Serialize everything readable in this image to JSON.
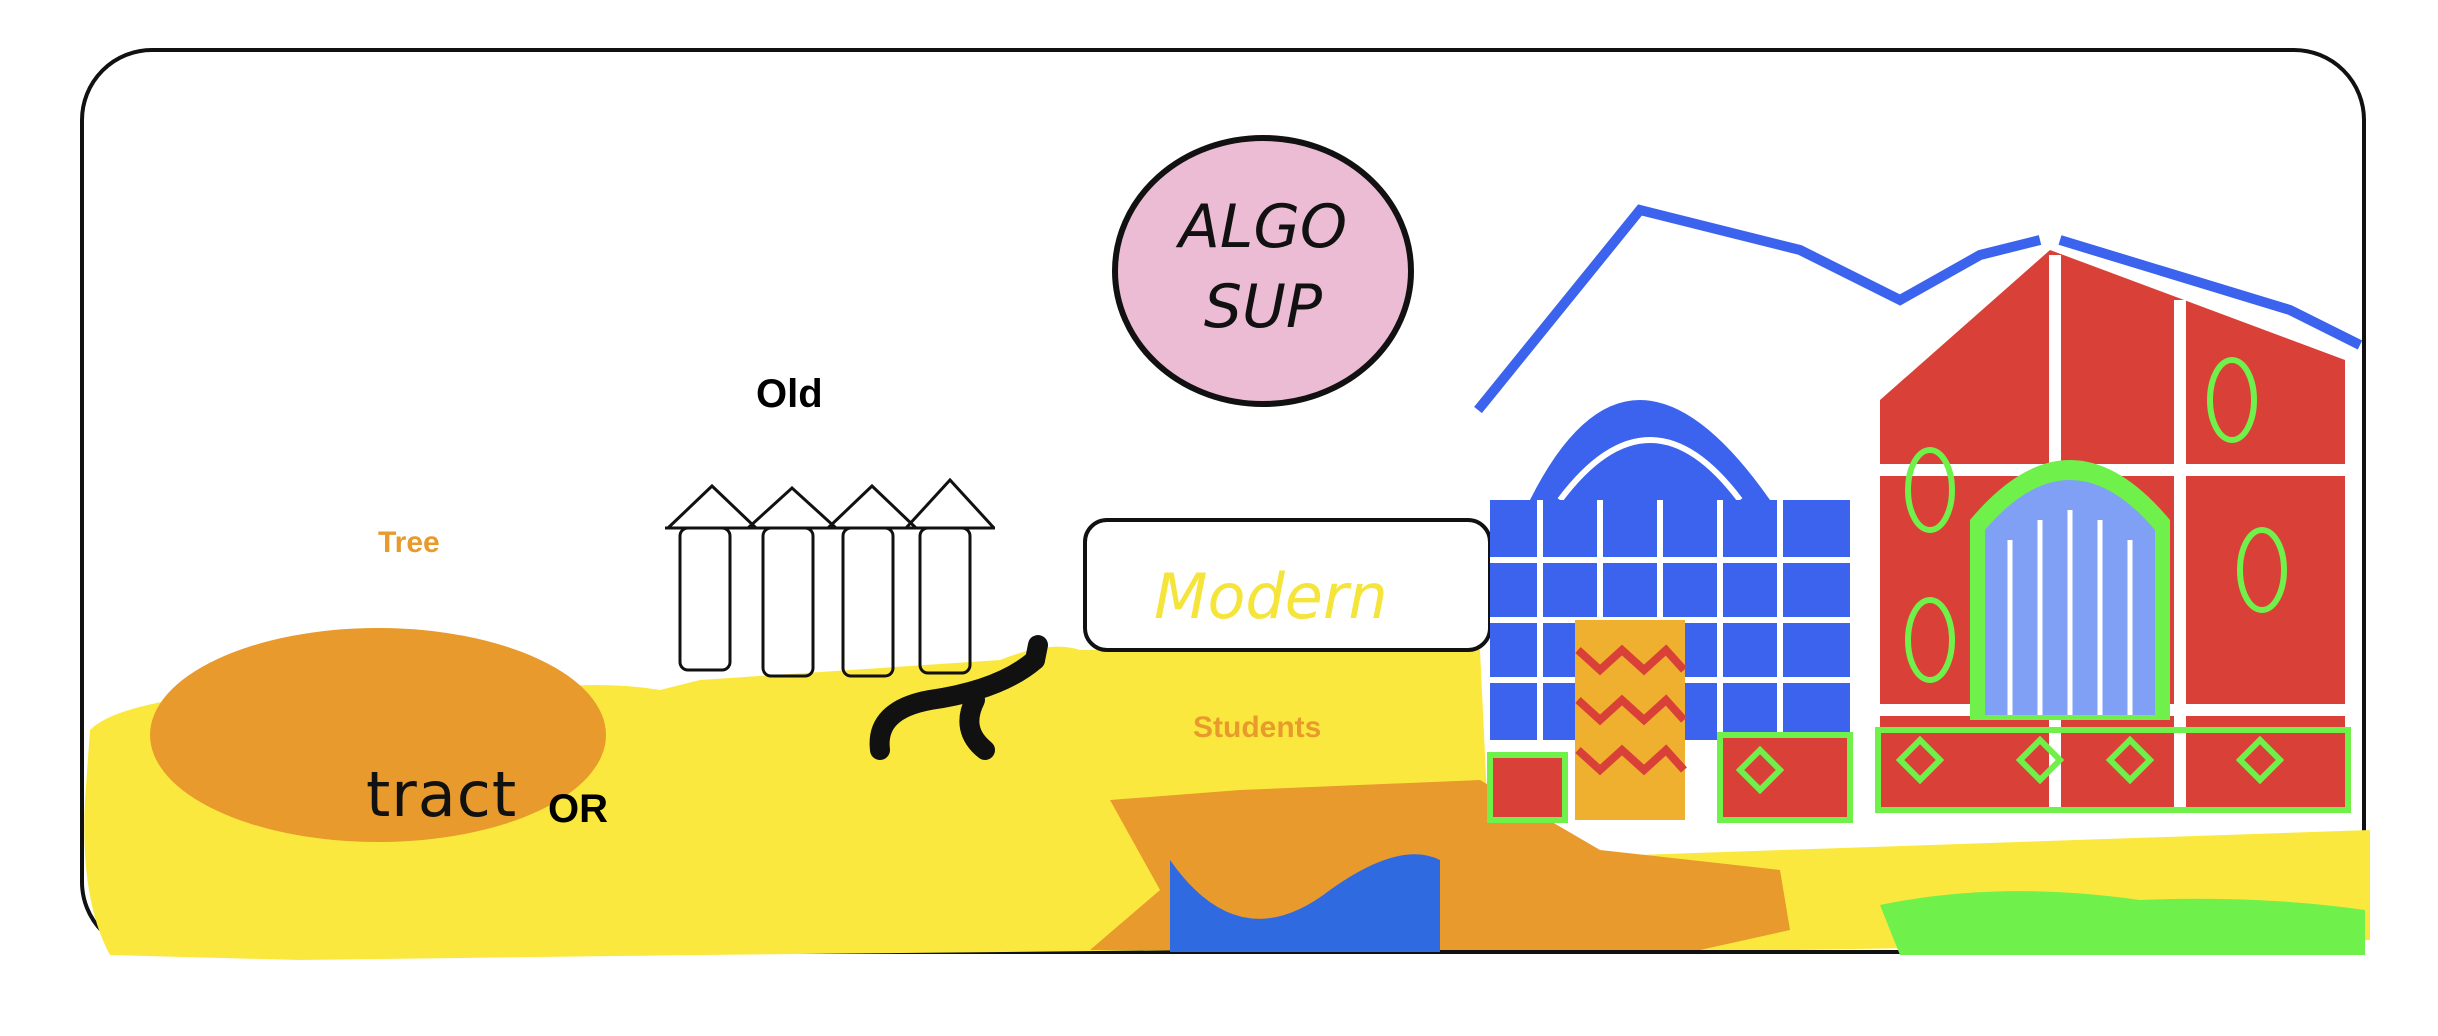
{
  "labels": {
    "old": "Old",
    "tree": "Tree",
    "students": "Students",
    "tractor_hand": "tract",
    "tractor_suffix": "OR",
    "modern": "Modern",
    "logo_line1": "ALGO",
    "logo_line2": "SUP"
  },
  "colors": {
    "ground_yellow": "#fbe83f",
    "tree_orange": "#e89a2c",
    "logo_pink": "#ecbcd4",
    "water_blue": "#2f6ae0",
    "building_blue": "#3b63ee",
    "building_red": "#d94138",
    "building_green": "#6ff04a"
  },
  "icons": [
    "logo-circle",
    "old-houses-sketch",
    "stick-figure",
    "modern-building",
    "tree-blob"
  ]
}
